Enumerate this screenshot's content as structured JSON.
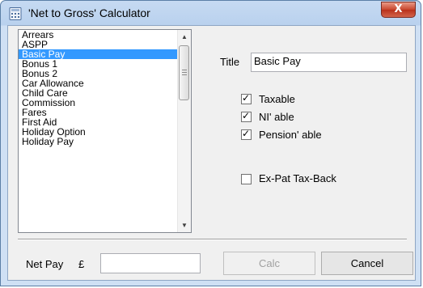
{
  "window": {
    "title": "'Net to Gross' Calculator",
    "close_label": "X",
    "app_icon": "calculator-icon"
  },
  "list": {
    "items": [
      "Arrears",
      "ASPP",
      "Basic Pay",
      "Bonus 1",
      "Bonus 2",
      "Car Allowance",
      "Child Care",
      "Commission",
      "Fares",
      "First Aid",
      "Holiday Option",
      "Holiday Pay"
    ],
    "selected": "Basic Pay",
    "scroll_up_icon": "arrow-up-icon",
    "scroll_down_icon": "arrow-down-icon"
  },
  "title_field": {
    "label": "Title",
    "value": "Basic Pay"
  },
  "options": {
    "taxable": {
      "label": "Taxable",
      "checked": true
    },
    "ni_able": {
      "label": "NI' able",
      "checked": true
    },
    "pension_able": {
      "label": "Pension' able",
      "checked": true
    },
    "expat": {
      "label": "Ex-Pat Tax-Back",
      "checked": false
    }
  },
  "net_pay": {
    "label": "Net Pay",
    "currency": "£",
    "value": ""
  },
  "buttons": {
    "calc": "Calc",
    "cancel": "Cancel"
  },
  "colors": {
    "selection": "#3399ff",
    "close": "#c8462d",
    "frame": "#c6daf2"
  }
}
